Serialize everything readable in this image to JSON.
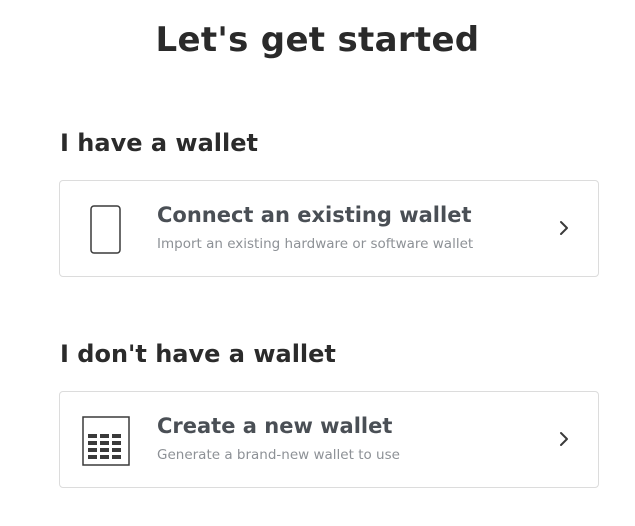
{
  "header": {
    "title": "Let's get started"
  },
  "sections": [
    {
      "heading": "I have a wallet",
      "card": {
        "title": "Connect an existing wallet",
        "subtitle": "Import an existing hardware or software wallet",
        "icon": "device-icon"
      }
    },
    {
      "heading": "I don't have a wallet",
      "card": {
        "title": "Create a new wallet",
        "subtitle": "Generate a brand-new wallet to use",
        "icon": "keypad-grid-icon"
      }
    }
  ],
  "colors": {
    "border": "#dcdcdc",
    "title_text": "#2a2a2a",
    "card_title": "#4a4f55",
    "card_subtitle": "#8d9196"
  }
}
